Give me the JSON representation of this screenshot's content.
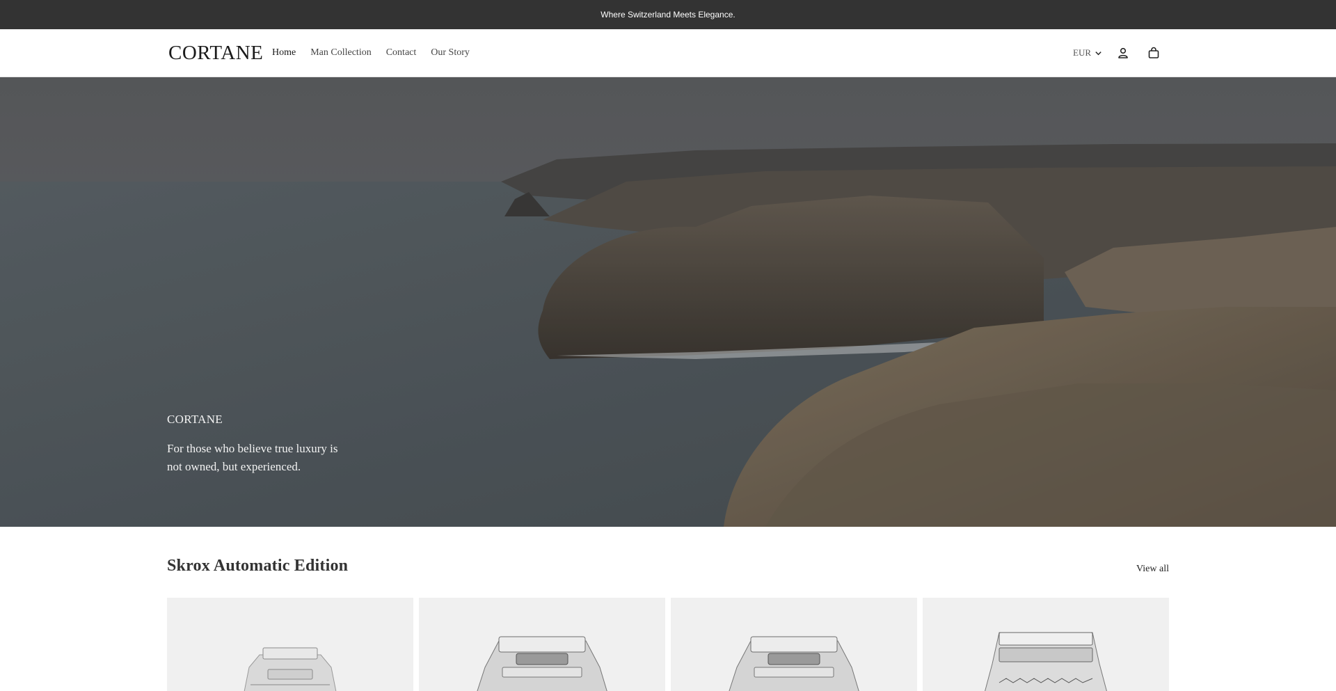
{
  "announcement": {
    "text": "Where Switzerland Meets Elegance."
  },
  "header": {
    "logo": "CORTANE",
    "nav": [
      {
        "label": "Home",
        "active": true
      },
      {
        "label": "Man Collection",
        "active": false
      },
      {
        "label": "Contact",
        "active": false
      },
      {
        "label": "Our Story",
        "active": false
      }
    ],
    "currency": "EUR",
    "icons": {
      "account": "account-icon",
      "cart": "cart-icon",
      "currency_caret": "chevron-down-icon"
    }
  },
  "hero": {
    "brand": "CORTANE",
    "tagline": "For those who believe true luxury is not owned, but experienced."
  },
  "collection": {
    "title": "Skrox Automatic Edition",
    "view_all": "View all",
    "products": [
      {
        "image": "watch-image"
      },
      {
        "image": "watch-image"
      },
      {
        "image": "watch-image"
      },
      {
        "image": "watch-image"
      }
    ]
  },
  "colors": {
    "announcement_bg": "#333333",
    "card_bg": "#f0f0f0",
    "text": "#222222"
  }
}
